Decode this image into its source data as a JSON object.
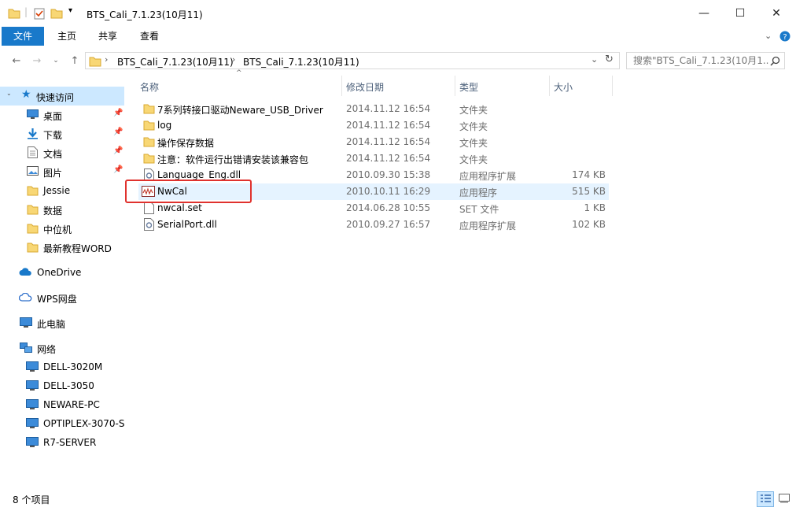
{
  "window": {
    "title": "BTS_Cali_7.1.23(10月11)",
    "minimize": "—",
    "maximize": "☐",
    "close": "✕"
  },
  "ribbon": {
    "tabs": [
      {
        "label": "文件",
        "active": true
      },
      {
        "label": "主页",
        "active": false
      },
      {
        "label": "共享",
        "active": false
      },
      {
        "label": "查看",
        "active": false
      }
    ]
  },
  "address": {
    "crumbs": [
      "BTS_Cali_7.1.23(10月11)",
      "BTS_Cali_7.1.23(10月11)"
    ]
  },
  "search": {
    "placeholder": "搜索\"BTS_Cali_7.1.23(10月1..."
  },
  "nav": {
    "quick_access": "快速访问",
    "items": [
      {
        "label": "桌面",
        "icon": "desktop-icon",
        "pinned": true
      },
      {
        "label": "下载",
        "icon": "download-icon",
        "pinned": true
      },
      {
        "label": "文档",
        "icon": "document-icon",
        "pinned": true
      },
      {
        "label": "图片",
        "icon": "picture-icon",
        "pinned": true
      },
      {
        "label": "Jessie",
        "icon": "folder-icon",
        "pinned": false
      },
      {
        "label": "数据",
        "icon": "folder-icon",
        "pinned": false
      },
      {
        "label": "中位机",
        "icon": "folder-icon",
        "pinned": false
      },
      {
        "label": "最新教程WORD",
        "icon": "folder-icon",
        "pinned": false
      }
    ],
    "onedrive": "OneDrive",
    "wps": "WPS网盘",
    "this_pc": "此电脑",
    "network": "网络",
    "computers": [
      "DELL-3020M",
      "DELL-3050",
      "NEWARE-PC",
      "OPTIPLEX-3070-S",
      "R7-SERVER"
    ]
  },
  "columns": {
    "name": "名称",
    "date": "修改日期",
    "type": "类型",
    "size": "大小"
  },
  "files": [
    {
      "name": "7系列转接口驱动Neware_USB_Driver",
      "date": "2014.11.12 16:54",
      "type": "文件夹",
      "size": "",
      "icon": "folder-icon"
    },
    {
      "name": "log",
      "date": "2014.11.12 16:54",
      "type": "文件夹",
      "size": "",
      "icon": "folder-icon"
    },
    {
      "name": "操作保存数据",
      "date": "2014.11.12 16:54",
      "type": "文件夹",
      "size": "",
      "icon": "folder-icon"
    },
    {
      "name": "注意：软件运行出错请安装该兼容包",
      "date": "2014.11.12 16:54",
      "type": "文件夹",
      "size": "",
      "icon": "folder-icon"
    },
    {
      "name": "Language_Eng.dll",
      "date": "2010.09.30 15:38",
      "type": "应用程序扩展",
      "size": "174 KB",
      "icon": "dll-icon"
    },
    {
      "name": "NwCal",
      "date": "2010.10.11 16:29",
      "type": "应用程序",
      "size": "515 KB",
      "icon": "app-icon",
      "selected": true
    },
    {
      "name": "nwcal.set",
      "date": "2014.06.28 10:55",
      "type": "SET 文件",
      "size": "1 KB",
      "icon": "file-icon"
    },
    {
      "name": "SerialPort.dll",
      "date": "2010.09.27 16:57",
      "type": "应用程序扩展",
      "size": "102 KB",
      "icon": "dll-icon"
    }
  ],
  "status": {
    "count": "8 个项目"
  },
  "colors": {
    "accent": "#1979ca",
    "nav_selected": "#cce8ff",
    "row_selected": "#e5f3ff",
    "highlight": "#e0322e",
    "folder": "#f8d775"
  }
}
